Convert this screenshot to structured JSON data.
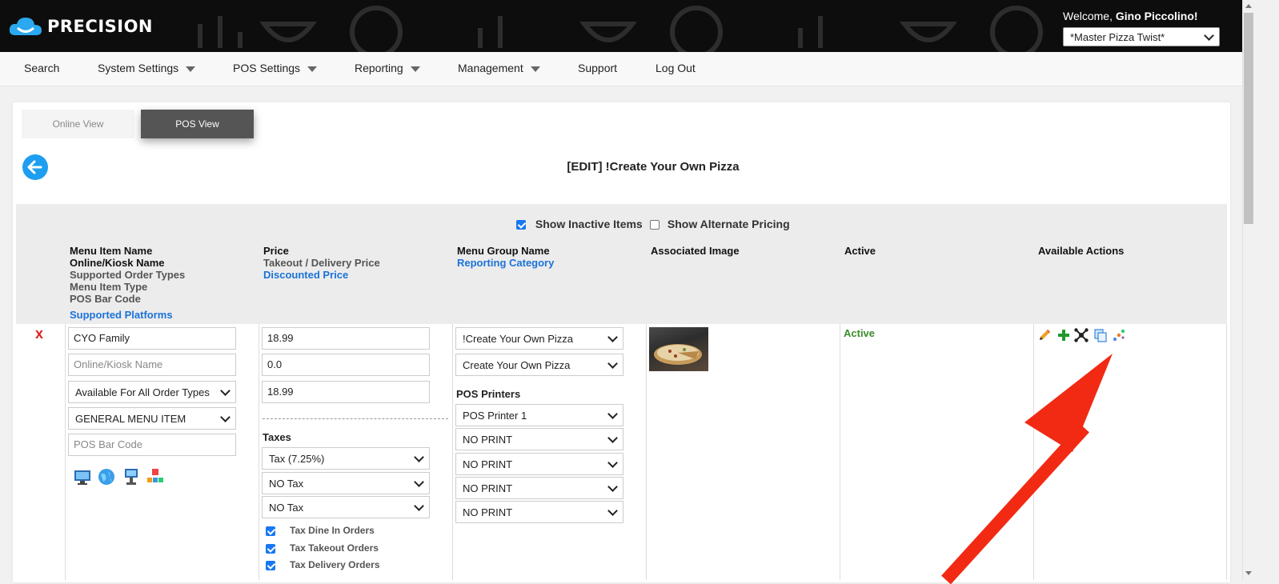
{
  "brand": {
    "logo_text": "PRECISION"
  },
  "header": {
    "welcome_prefix": "Welcome, ",
    "user_name": "Gino Piccolino!",
    "location": "*Master Pizza Twist*"
  },
  "nav": {
    "search": "Search",
    "system_settings": "System Settings",
    "pos_settings": "POS Settings",
    "reporting": "Reporting",
    "management": "Management",
    "support": "Support",
    "logout": "Log Out"
  },
  "tabs": {
    "online": "Online View",
    "pos": "POS View"
  },
  "page": {
    "title": "[EDIT] !Create Your Own Pizza"
  },
  "filters": {
    "show_inactive": "Show Inactive Items",
    "show_inactive_checked": true,
    "show_alternate": "Show Alternate Pricing",
    "show_alternate_checked": false
  },
  "columns": {
    "name": {
      "l1": "Menu Item Name",
      "l2": "Online/Kiosk Name",
      "l3": "Supported Order Types",
      "l4": "Menu Item Type",
      "l5": "POS Bar Code",
      "l6": "Supported Platforms"
    },
    "price": {
      "l1": "Price",
      "l2": "Takeout / Delivery Price",
      "l3": "Discounted Price"
    },
    "group": {
      "l1": "Menu Group Name",
      "l2": "Reporting Category"
    },
    "image": "Associated Image",
    "active": "Active",
    "actions": "Available Actions"
  },
  "item": {
    "delete_mark": "x",
    "name": "CYO Family",
    "online_name_placeholder": "Online/Kiosk Name",
    "order_types": "Available For All Order Types",
    "item_type": "GENERAL MENU ITEM",
    "barcode_placeholder": "POS Bar Code",
    "platforms": [
      "desktop-pos-icon",
      "globe-online-icon",
      "kiosk-icon",
      "third-party-icon"
    ],
    "price": "18.99",
    "takeout_price": "0.0",
    "discounted_price": "18.99",
    "taxes_label": "Taxes",
    "taxes": [
      "Tax (7.25%)",
      "NO Tax",
      "NO Tax"
    ],
    "tax_dine_in": "Tax Dine In Orders",
    "tax_takeout": "Tax Takeout Orders",
    "tax_delivery": "Tax Delivery Orders",
    "menu_group": "!Create Your Own Pizza",
    "reporting_category": "Create Your Own Pizza",
    "printers_label": "POS Printers",
    "printers": [
      "POS Printer 1",
      "NO PRINT",
      "NO PRINT",
      "NO PRINT",
      "NO PRINT"
    ],
    "image_alt": "pizza-thumbnail",
    "status": "Active",
    "actions": [
      "pencil-edit-icon",
      "plus-add-icon",
      "modifier-network-icon",
      "copy-icon",
      "connect-dots-icon"
    ]
  },
  "colors": {
    "accent_blue": "#1a73d9",
    "active_green": "#3b8b2d",
    "delete_red": "#dd2222",
    "annotation_arrow": "#f22a14"
  }
}
